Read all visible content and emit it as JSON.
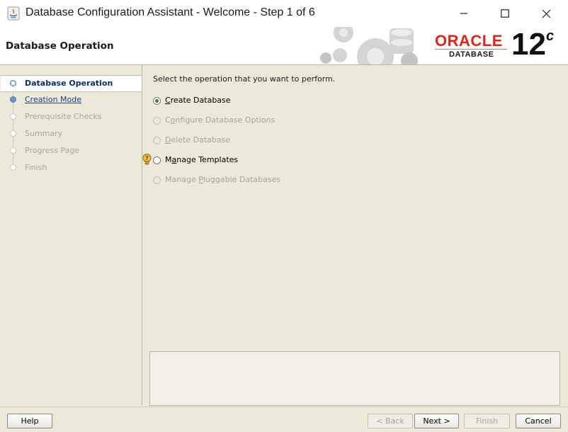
{
  "window": {
    "title": "Database Configuration Assistant - Welcome - Step 1 of 6"
  },
  "header": {
    "page_title": "Database Operation",
    "brand": "ORACLE",
    "brand_sub": "DATABASE",
    "version": "12",
    "version_suffix": "c"
  },
  "steps": [
    {
      "label": "Database Operation",
      "state": "active"
    },
    {
      "label": "Creation Mode",
      "state": "link"
    },
    {
      "label": "Prerequisite Checks",
      "state": "disabled"
    },
    {
      "label": "Summary",
      "state": "disabled"
    },
    {
      "label": "Progress Page",
      "state": "disabled"
    },
    {
      "label": "Finish",
      "state": "disabled"
    }
  ],
  "content": {
    "prompt": "Select the operation that you want to perform.",
    "options": [
      {
        "label": "Create Database",
        "mnemonic": "C",
        "rest": "reate Database",
        "selected": true,
        "enabled": true
      },
      {
        "label": "Configure Database Options",
        "mnemonic": "o",
        "pre": "C",
        "rest": "nfigure Database Options",
        "selected": false,
        "enabled": false
      },
      {
        "label": "Delete Database",
        "mnemonic": "D",
        "rest": "elete Database",
        "selected": false,
        "enabled": false
      },
      {
        "label": "Manage Templates",
        "mnemonic": "a",
        "pre": "M",
        "rest": "nage Templates",
        "selected": false,
        "enabled": true
      },
      {
        "label": "Manage Pluggable Databases",
        "mnemonic": "P",
        "pre": "Manage ",
        "rest": "luggable Databases",
        "selected": false,
        "enabled": false
      }
    ]
  },
  "buttons": {
    "help": "Help",
    "back": "< Back",
    "next": "Next >",
    "finish": "Finish",
    "cancel": "Cancel"
  },
  "colors": {
    "background": "#ece9d8",
    "oracle_red": "#e2231a",
    "active_step": "#0b2d6b",
    "link_step": "#1f3f8a",
    "disabled_text": "#a7a599"
  }
}
